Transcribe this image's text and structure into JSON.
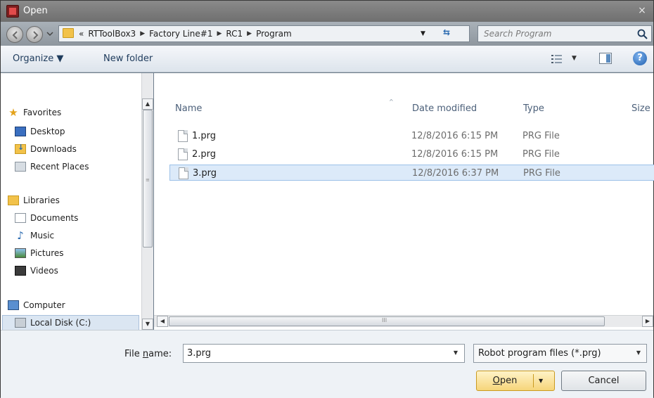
{
  "window": {
    "title": "Open",
    "close_symbol": "×"
  },
  "address": {
    "prefix": "«",
    "crumbs": [
      "RTToolBox3",
      "Factory Line#1",
      "RC1",
      "Program"
    ],
    "sep": "▶",
    "dropdown": "▼",
    "refresh": "⇆"
  },
  "search": {
    "placeholder": "Search Program"
  },
  "toolbar": {
    "organize": "Organize ▼",
    "new_folder": "New folder",
    "views_drop": "▼",
    "help": "?"
  },
  "nav": {
    "favorites": "Favorites",
    "desktop": "Desktop",
    "downloads": "Downloads",
    "recent_places": "Recent Places",
    "libraries": "Libraries",
    "documents": "Documents",
    "music": "Music",
    "pictures": "Pictures",
    "videos": "Videos",
    "computer": "Computer",
    "local_disk": "Local Disk (C:)"
  },
  "scroll": {
    "up": "▲",
    "down": "▼",
    "left": "◀",
    "right": "▶",
    "grip_v": "≡",
    "grip_h": "III"
  },
  "columns": {
    "name": "Name",
    "date": "Date modified",
    "type": "Type",
    "size": "Size",
    "sort": "^"
  },
  "files": [
    {
      "name": "1.prg",
      "date": "12/8/2016 6:15 PM",
      "type": "PRG File",
      "selected": false
    },
    {
      "name": "2.prg",
      "date": "12/8/2016 6:15 PM",
      "type": "PRG File",
      "selected": false
    },
    {
      "name": "3.prg",
      "date": "12/8/2016 6:37 PM",
      "type": "PRG File",
      "selected": true
    }
  ],
  "footer": {
    "filename_label_pre": "File ",
    "filename_label_u": "n",
    "filename_label_post": "ame:",
    "filename_value": "3.prg",
    "filename_drop": "▼",
    "filter_value": "Robot program files (*.prg)",
    "filter_drop": "▼",
    "open_u": "O",
    "open_rest": "pen",
    "open_drop": "▼",
    "cancel": "Cancel"
  }
}
